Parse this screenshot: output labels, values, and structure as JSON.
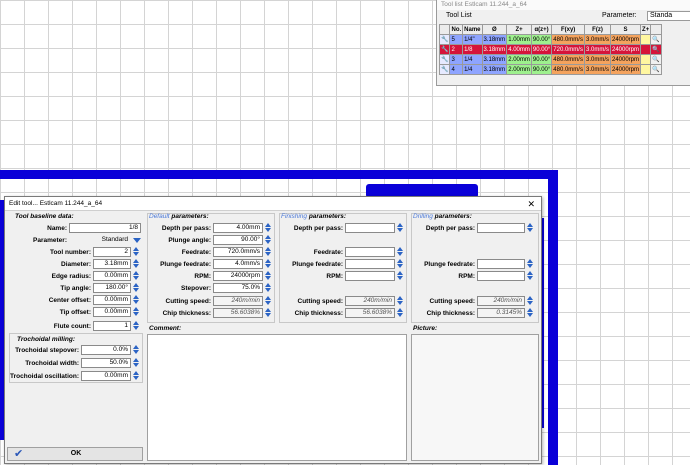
{
  "tool_list": {
    "title": "Tool list Estlcam 11.244_a_64",
    "label": "Tool List",
    "parameter_label": "Parameter:",
    "parameter_value": "Standa",
    "columns": [
      "No.",
      "Name",
      "Ø",
      "Z+",
      "α(z+)",
      "F(xy)",
      "F(z)",
      "S",
      "Z+"
    ],
    "rows": [
      {
        "no": "5",
        "name": "1/4\"",
        "diam": "3.18mm",
        "z": "1.00mm",
        "angle": "90.00°",
        "fxy": "480.0mm/s",
        "fz": "3.0mm/s",
        "s": "24000rpm",
        "selected": false
      },
      {
        "no": "2",
        "name": "1/8",
        "diam": "3.18mm",
        "z": "4.00mm",
        "angle": "90.00°",
        "fxy": "720.0mm/s",
        "fz": "3.0mm/s",
        "s": "24000rpm",
        "selected": true
      },
      {
        "no": "3",
        "name": "1/4",
        "diam": "3.18mm",
        "z": "2.00mm",
        "angle": "90.00°",
        "fxy": "480.0mm/s",
        "fz": "3.0mm/s",
        "s": "24000rpm",
        "selected": false
      },
      {
        "no": "4",
        "name": "1/4",
        "diam": "3.18mm",
        "z": "2.00mm",
        "angle": "90.00°",
        "fxy": "480.0mm/s",
        "fz": "3.0mm/s",
        "s": "24000rpm",
        "selected": false
      }
    ]
  },
  "dialog": {
    "title": "Edit tool... Estlcam 11.244_a_64",
    "close": "✕",
    "baseline": {
      "header": "Tool baseline data:",
      "name_label": "Name:",
      "name_value": "1/8",
      "parameter_label": "Parameter:",
      "parameter_value": "Standard",
      "tool_number_label": "Tool number:",
      "tool_number_value": "2",
      "diameter_label": "Diameter:",
      "diameter_value": "3.18mm",
      "edge_radius_label": "Edge radius:",
      "edge_radius_value": "0.00mm",
      "tip_angle_label": "Tip angle:",
      "tip_angle_value": "180.00°",
      "center_offset_label": "Center offset:",
      "center_offset_value": "0.00mm",
      "tip_offset_label": "Tip offset:",
      "tip_offset_value": "0.00mm",
      "flute_count_label": "Flute count:",
      "flute_count_value": "1"
    },
    "trochoidal": {
      "header": "Trochoidal milling:",
      "stepover_label": "Trochoidal stepover:",
      "stepover_value": "0.0%",
      "width_label": "Trochoidal width:",
      "width_value": "50.0%",
      "oscillation_label": "Trochoidal oscillation:",
      "oscillation_value": "0.00mm"
    },
    "default_params": {
      "header_accent": "Default",
      "header_rest": " parameters:",
      "depth_label": "Depth per pass:",
      "depth_value": "4.00mm",
      "plunge_angle_label": "Plunge angle:",
      "plunge_angle_value": "90.00°",
      "feedrate_label": "Feedrate:",
      "feedrate_value": "720.0mm/s",
      "plunge_feedrate_label": "Plunge feedrate:",
      "plunge_feedrate_value": "4.0mm/s",
      "rpm_label": "RPM:",
      "rpm_value": "24000rpm",
      "stepover_label": "Stepover:",
      "stepover_value": "75.0%",
      "cutting_speed_label": "Cutting speed:",
      "cutting_speed_value": "240m/min",
      "chip_thickness_label": "Chip thickness:",
      "chip_thickness_value": "56.6038%"
    },
    "finishing_params": {
      "header_accent": "Finishing",
      "header_rest": " parameters:",
      "depth_label": "Depth per pass:",
      "feedrate_label": "Feedrate:",
      "plunge_feedrate_label": "Plunge feedrate:",
      "rpm_label": "RPM:",
      "cutting_speed_label": "Cutting speed:",
      "cutting_speed_value": "240m/min",
      "chip_thickness_label": "Chip thickness:",
      "chip_thickness_value": "56.6038%"
    },
    "drilling_params": {
      "header_accent": "Drilling",
      "header_rest": " parameters:",
      "depth_label": "Depth per pass:",
      "plunge_feedrate_label": "Plunge feedrate:",
      "rpm_label": "RPM:",
      "cutting_speed_label": "Cutting speed:",
      "cutting_speed_value": "240m/min",
      "chip_thickness_label": "Chip thickness:",
      "chip_thickness_value": "0.3145%"
    },
    "comment_label": "Comment:",
    "picture_label": "Picture:",
    "ok_label": "OK"
  },
  "colors": {
    "accent": "#2b63c4",
    "selected_row": "#d5143a",
    "cad_blue": "#0a00d8"
  },
  "icons": [
    "wrench-icon",
    "spinner-icon",
    "dropdown-arrow-icon",
    "check-icon",
    "close-icon",
    "search-icon"
  ]
}
